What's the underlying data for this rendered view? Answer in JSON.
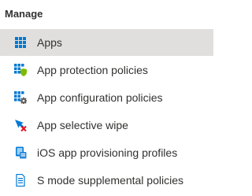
{
  "section": {
    "title": "Manage"
  },
  "items": [
    {
      "label": "Apps",
      "icon": "apps-grid-icon",
      "selected": true
    },
    {
      "label": "App protection policies",
      "icon": "app-protection-shield-icon",
      "selected": false
    },
    {
      "label": "App configuration policies",
      "icon": "app-configuration-gear-icon",
      "selected": false
    },
    {
      "label": "App selective wipe",
      "icon": "selective-wipe-x-icon",
      "selected": false
    },
    {
      "label": "iOS app provisioning profiles",
      "icon": "ios-provisioning-icon",
      "selected": false
    },
    {
      "label": "S mode supplemental policies",
      "icon": "document-policy-icon",
      "selected": false
    }
  ],
  "colors": {
    "selected_background": "#e1dfdd",
    "icon_blue": "#0078d4",
    "icon_green": "#7fba00",
    "icon_gray": "#605e5c",
    "icon_red": "#e81123",
    "text": "#323130"
  }
}
